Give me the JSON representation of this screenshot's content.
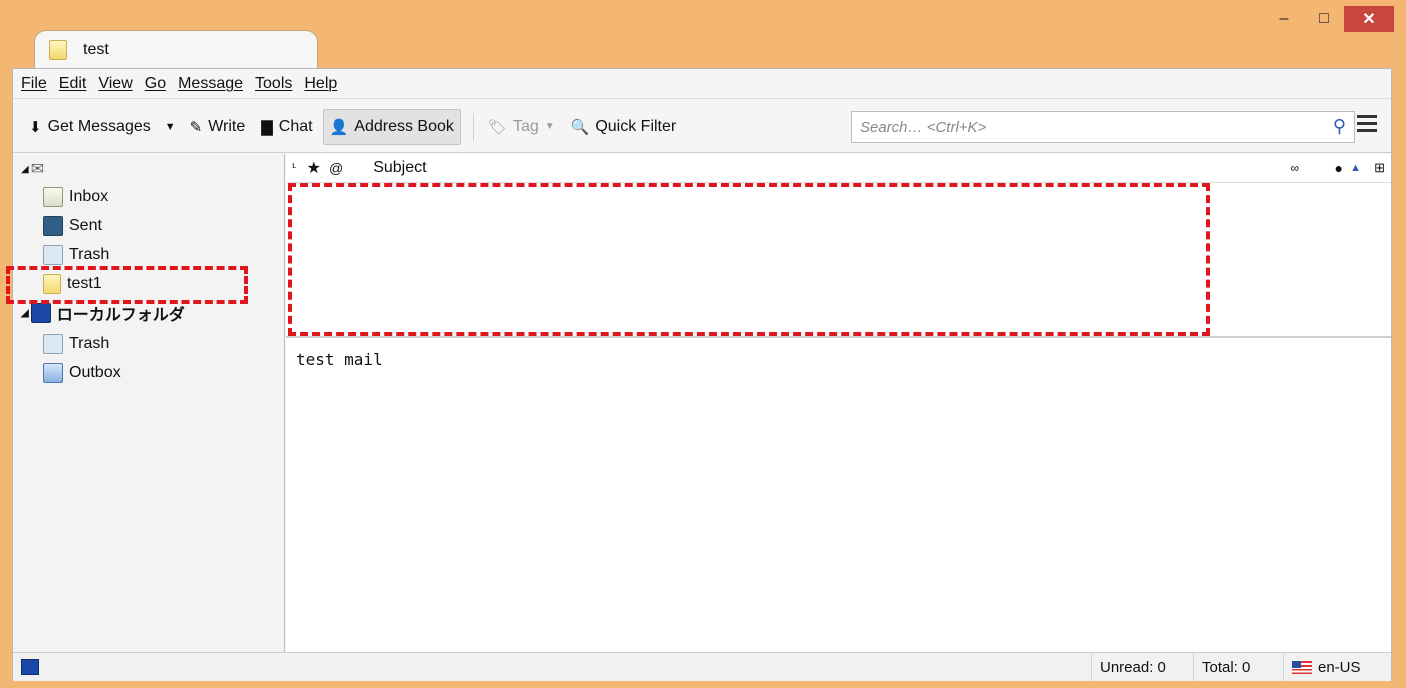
{
  "window": {
    "minimize": "–",
    "maximize": "□",
    "close": "✕"
  },
  "tab": {
    "title": "test"
  },
  "menu": [
    "File",
    "Edit",
    "View",
    "Go",
    "Message",
    "Tools",
    "Help"
  ],
  "toolbar": {
    "get_messages": "Get Messages",
    "write": "Write",
    "chat": "Chat",
    "address_book": "Address Book",
    "tag": "Tag",
    "quick_filter": "Quick Filter",
    "search_placeholder": "Search… <Ctrl+K>"
  },
  "folders": {
    "inbox": "Inbox",
    "sent": "Sent",
    "trash": "Trash",
    "test1": "test1",
    "local_folders": "ローカルフォルダ",
    "local_trash": "Trash",
    "outbox": "Outbox"
  },
  "thread": {
    "subject_header": "Subject"
  },
  "message": {
    "body": "test mail"
  },
  "status": {
    "unread": "Unread: 0",
    "total": "Total: 0",
    "lang": "en-US"
  },
  "colors": {
    "frame": "#f3b673",
    "highlight_dash": "#e0161d"
  }
}
